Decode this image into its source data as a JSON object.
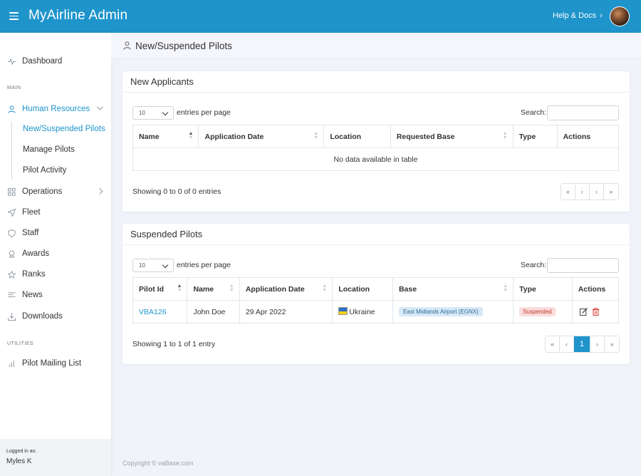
{
  "app": {
    "title": "MyAirline Admin",
    "help_label": "Help & Docs"
  },
  "sidebar": {
    "dashboard": "Dashboard",
    "section_main": "MAIN",
    "human_resources": "Human Resources",
    "hr_items": [
      "New/Suspended Pilots",
      "Manage Pilots",
      "Pilot Activity"
    ],
    "operations": "Operations",
    "fleet": "Fleet",
    "staff": "Staff",
    "awards": "Awards",
    "ranks": "Ranks",
    "news": "News",
    "downloads": "Downloads",
    "section_utilities": "UTILITIES",
    "mailing_list": "Pilot Mailing List",
    "logged_in_label": "Logged in as:",
    "logged_in_user": "Myles K"
  },
  "page": {
    "title": "New/Suspended Pilots"
  },
  "new_applicants": {
    "title": "New Applicants",
    "entries_value": "10",
    "entries_label": "entries per page",
    "search_label": "Search:",
    "columns": [
      "Name",
      "Application Date",
      "Location",
      "Requested Base",
      "Type",
      "Actions"
    ],
    "empty_text": "No data available in table",
    "info": "Showing 0 to 0 of 0 entries",
    "pager": [
      "«",
      "‹",
      "›",
      "»"
    ]
  },
  "suspended": {
    "title": "Suspended Pilots",
    "entries_value": "10",
    "entries_label": "entries per page",
    "search_label": "Search:",
    "columns": [
      "Pilot Id",
      "Name",
      "Application Date",
      "Location",
      "Base",
      "Type",
      "Actions"
    ],
    "rows": [
      {
        "pilot_id": "VBA126",
        "name": "John Doe",
        "date": "29 Apr 2022",
        "location": "Ukraine",
        "base": "East Midlands Airport (EGNX)",
        "type": "Suspended"
      }
    ],
    "info": "Showing 1 to 1 of 1 entry",
    "pager": [
      "«",
      "‹",
      "1",
      "›",
      "»"
    ]
  },
  "footer": "Copyright © vaBase.com",
  "colors": {
    "primary": "#1e94cb",
    "danger": "#d9342b"
  }
}
